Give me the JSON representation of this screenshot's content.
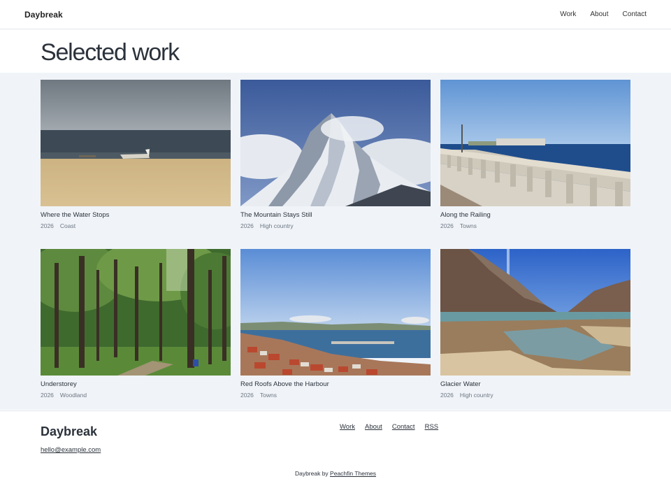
{
  "header": {
    "site_title": "Daybreak",
    "nav": [
      "Work",
      "About",
      "Contact"
    ]
  },
  "page": {
    "title": "Selected work"
  },
  "works": [
    {
      "title": "Where the Water Stops",
      "year": "2026",
      "category": "Coast"
    },
    {
      "title": "The Mountain Stays Still",
      "year": "2026",
      "category": "High country"
    },
    {
      "title": "Along the Railing",
      "year": "2026",
      "category": "Towns"
    },
    {
      "title": "Understorey",
      "year": "2026",
      "category": "Woodland"
    },
    {
      "title": "Red Roofs Above the Harbour",
      "year": "2026",
      "category": "Towns"
    },
    {
      "title": "Glacier Water",
      "year": "2026",
      "category": "High country"
    }
  ],
  "footer": {
    "brand": "Daybreak",
    "email": "hello@example.com",
    "nav": [
      "Work",
      "About",
      "Contact",
      "RSS"
    ],
    "credit_prefix": "Daybreak by",
    "credit_link": "Peachfin Themes"
  },
  "colors": {
    "section_background": "#f0f4f9",
    "text": "#2b323b",
    "muted": "#6d7580"
  }
}
